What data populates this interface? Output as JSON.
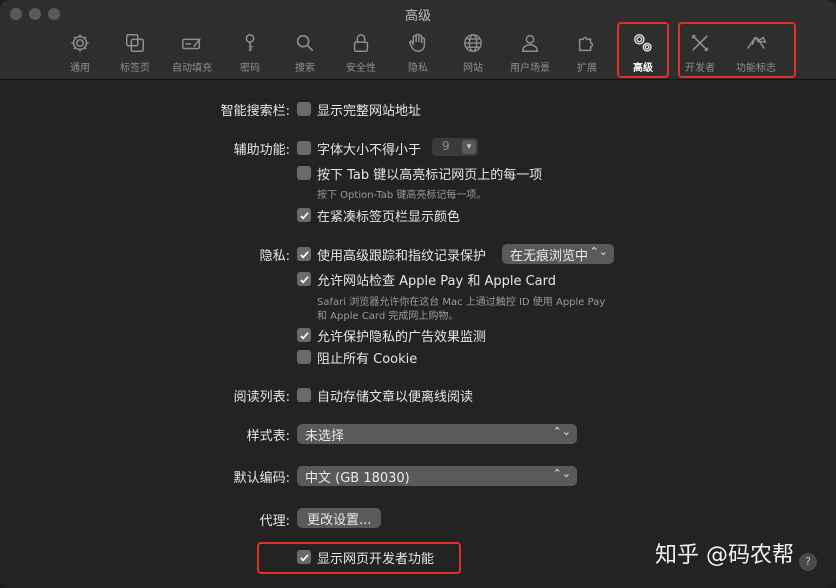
{
  "window": {
    "title": "高级"
  },
  "toolbar": {
    "items": [
      {
        "label": "通用",
        "icon": "gear-icon"
      },
      {
        "label": "标签页",
        "icon": "tabs-icon"
      },
      {
        "label": "自动填充",
        "icon": "autofill-icon"
      },
      {
        "label": "密码",
        "icon": "key-icon"
      },
      {
        "label": "搜索",
        "icon": "search-icon"
      },
      {
        "label": "安全性",
        "icon": "lock-icon"
      },
      {
        "label": "隐私",
        "icon": "hand-icon"
      },
      {
        "label": "网站",
        "icon": "globe-icon"
      },
      {
        "label": "用户场景",
        "icon": "person-icon"
      },
      {
        "label": "扩展",
        "icon": "puzzle-icon"
      },
      {
        "label": "高级",
        "icon": "gears-icon",
        "selected": true
      },
      {
        "label": "开发者",
        "icon": "tools-icon"
      },
      {
        "label": "功能标志",
        "icon": "flags-icon"
      }
    ]
  },
  "settings": {
    "smart_search": {
      "label": "智能搜索栏:",
      "option": "显示完整网站地址",
      "checked": false
    },
    "accessibility": {
      "label": "辅助功能:",
      "min_font": {
        "option": "字体大小不得小于",
        "checked": false,
        "value": "9"
      },
      "tab_highlight": {
        "option": "按下 Tab 键以高亮标记网页上的每一项",
        "checked": false,
        "note": "按下 Option-Tab 键高亮标记每一项。"
      },
      "compact_color": {
        "option": "在紧凑标签页栏显示颜色",
        "checked": true
      }
    },
    "privacy": {
      "label": "隐私:",
      "tracking": {
        "option": "使用高级跟踪和指纹记录保护",
        "checked": true,
        "mode": "在无痕浏览中"
      },
      "apple_pay": {
        "option": "允许网站检查 Apple Pay 和 Apple Card",
        "checked": true,
        "note_line1": "Safari 浏览器允许你在这台 Mac 上通过触控 ID 使用 Apple Pay",
        "note_line2": "和 Apple Card 完成网上购物。"
      },
      "ad_measurement": {
        "option": "允许保护隐私的广告效果监测",
        "checked": true
      },
      "block_cookies": {
        "option": "阻止所有 Cookie",
        "checked": false
      }
    },
    "reading_list": {
      "label": "阅读列表:",
      "option": "自动存储文章以便离线阅读",
      "checked": false
    },
    "stylesheet": {
      "label": "样式表:",
      "value": "未选择"
    },
    "encoding": {
      "label": "默认编码:",
      "value": "中文 (GB 18030)"
    },
    "proxy": {
      "label": "代理:",
      "button": "更改设置..."
    },
    "developer": {
      "option": "显示网页开发者功能",
      "checked": true
    }
  },
  "watermark": "知乎 @码农帮",
  "help_label": "?",
  "colors": {
    "highlight": "#e0302a",
    "background": "#232323",
    "toolbar": "#2e2e2e"
  }
}
